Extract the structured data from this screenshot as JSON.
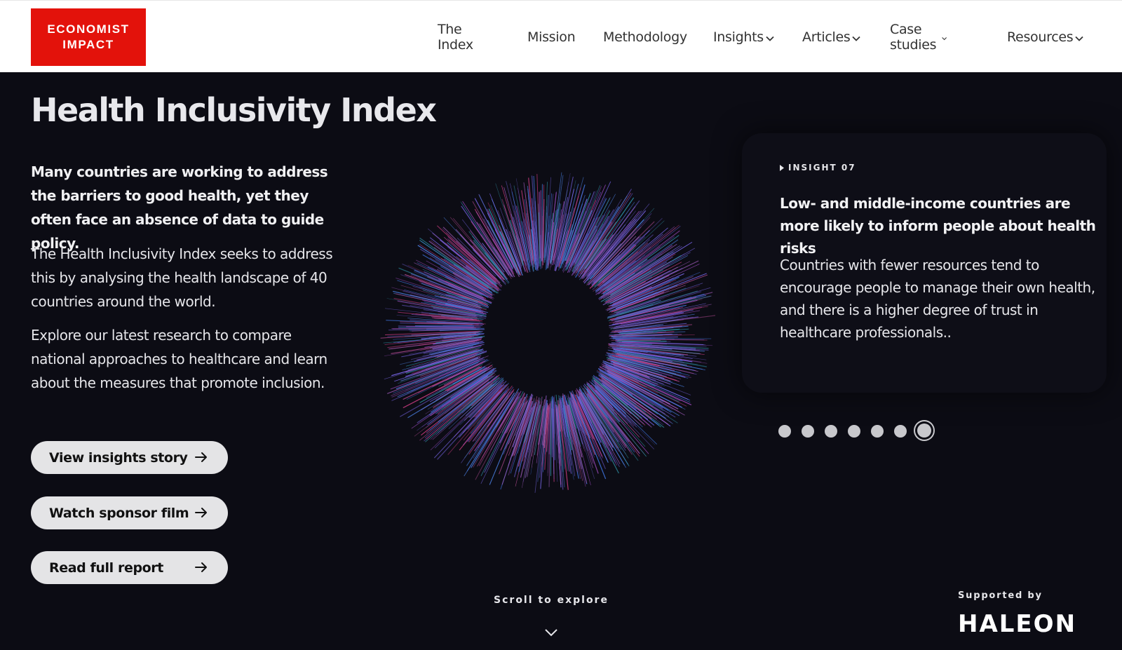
{
  "header": {
    "logo_line1": "ECONOMIST",
    "logo_line2": "IMPACT",
    "brand_color": "#e3120b",
    "nav": [
      {
        "label": "The Index",
        "dropdown": false
      },
      {
        "label": "Mission",
        "dropdown": false
      },
      {
        "label": "Methodology",
        "dropdown": false
      },
      {
        "label": "Insights",
        "dropdown": true
      },
      {
        "label": "Articles",
        "dropdown": true
      },
      {
        "label": "Case studies",
        "dropdown": true
      },
      {
        "label": "Resources",
        "dropdown": true
      }
    ]
  },
  "hero": {
    "title": "Health Inclusivity Index",
    "lead": "Many countries are working to address the barriers to good health, yet they often face an absence of data to guide policy.",
    "para1": "The Health Inclusivity Index seeks to address this by analysing the health landscape of 40 countries around the world.",
    "para2": "Explore our latest research to compare national approaches to healthcare and learn about the measures that promote inclusion.",
    "buttons": [
      {
        "label": "View insights story"
      },
      {
        "label": "Watch sponsor film"
      },
      {
        "label": "Read full report"
      }
    ],
    "background_color": "#0c0c14"
  },
  "insight": {
    "kicker": "INSIGHT 07",
    "title": "Low- and middle-income countries are more likely to inform people about health risks",
    "body": "Countries with fewer resources tend to encourage people to manage their own health, and there is a higher degree of trust in healthcare professionals..",
    "total_slides": 7,
    "active_slide": 7
  },
  "footer": {
    "scroll_label": "Scroll to explore",
    "supported_label": "Supported by",
    "sponsor": "HALEON"
  }
}
